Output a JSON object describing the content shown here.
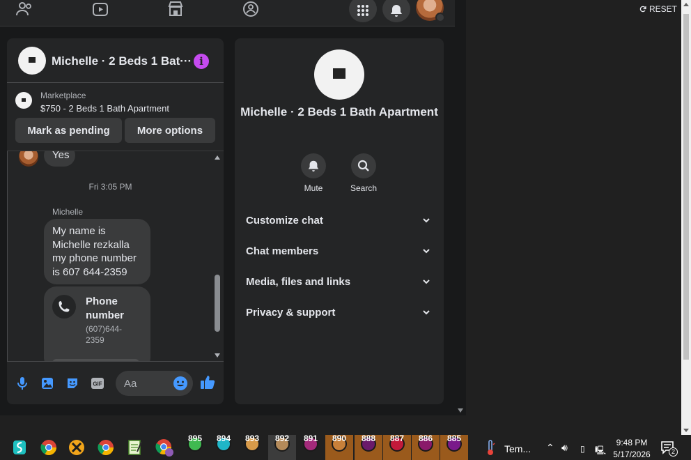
{
  "colors": {
    "page_bg": "#18191a",
    "surface": "#242526",
    "surface_alt": "#3a3b3c",
    "text_primary": "#e4e6eb",
    "text_secondary": "#b0b3b8",
    "messenger_blue": "#4599ff",
    "info_purple": "#c64bf0",
    "notification_red": "#e41e3f",
    "taskbar": "#202020"
  },
  "topnav": {
    "icons": [
      "friends-icon",
      "watch-icon",
      "marketplace-icon",
      "groups-icon"
    ],
    "menu_icon": "grid-menu-icon",
    "notification_icon": "bell-icon",
    "avatar": "profile-avatar"
  },
  "chat": {
    "title": "Michelle · 2 Beds 1 Bat···",
    "info_icon": "info-icon",
    "marketplace_label": "Marketplace",
    "listing": "$750 - 2 Beds 1 Bath Apartment",
    "buttons": {
      "mark_pending": "Mark as pending",
      "more_options": "More options"
    },
    "messages": {
      "earlier_reply": "Yes",
      "timestamp": "Fri 3:05 PM",
      "sender": "Michelle",
      "text": "My name is Michelle rezkalla my phone number is 607 644-2359",
      "phone_card": {
        "title": "Phone number",
        "number": "(607)644-2359",
        "icon": "phone-icon"
      }
    },
    "composer": {
      "icons": [
        "microphone-icon",
        "photo-icon",
        "sticker-icon",
        "gif-icon"
      ],
      "gif_text": "GIF",
      "placeholder": "Aa",
      "emoji_icon": "emoji-icon",
      "like_icon": "thumbs-up-icon"
    }
  },
  "info_panel": {
    "title": "Michelle · 2 Beds 1 Bath Apartment",
    "actions": [
      {
        "label": "Mute",
        "icon": "bell-icon"
      },
      {
        "label": "Search",
        "icon": "search-icon"
      }
    ],
    "sections": [
      "Customize chat",
      "Chat members",
      "Media, files and links",
      "Privacy & support"
    ]
  },
  "side": {
    "reset_label": "RESET",
    "reset_icon": "refresh-icon"
  },
  "taskbar": {
    "apps": [
      "surfshark-icon",
      "chrome-icon",
      "xodo-icon",
      "chrome-icon",
      "notepad-icon",
      "chrome-profile-icon"
    ],
    "weather_items": [
      "895",
      "894",
      "893",
      "892",
      "891",
      "890",
      "888",
      "887",
      "886",
      "885"
    ],
    "weather_label": "Tem...",
    "time": "9:48 PM",
    "date": "5/17/2026",
    "notifications_count": "2"
  }
}
